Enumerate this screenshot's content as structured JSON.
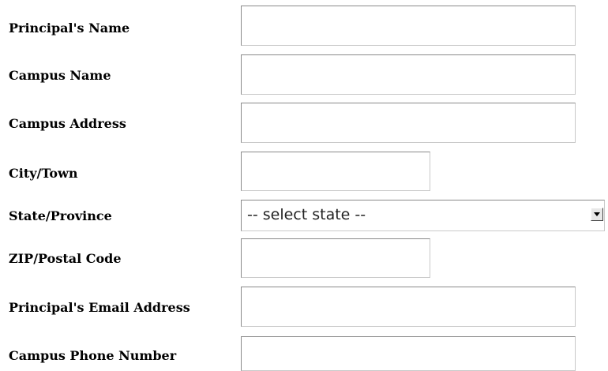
{
  "form": {
    "principal_name": {
      "label": "Principal's Name",
      "value": ""
    },
    "campus_name": {
      "label": "Campus Name",
      "value": ""
    },
    "campus_address": {
      "label": "Campus Address",
      "value": ""
    },
    "city": {
      "label": "City/Town",
      "value": ""
    },
    "state": {
      "label": "State/Province",
      "selected": "-- select state --",
      "icon": "chevron-down-icon"
    },
    "zip": {
      "label": "ZIP/Postal Code",
      "value": ""
    },
    "principal_email": {
      "label": "Principal's Email Address",
      "value": ""
    },
    "campus_phone": {
      "label": "Campus Phone Number",
      "value": ""
    }
  }
}
